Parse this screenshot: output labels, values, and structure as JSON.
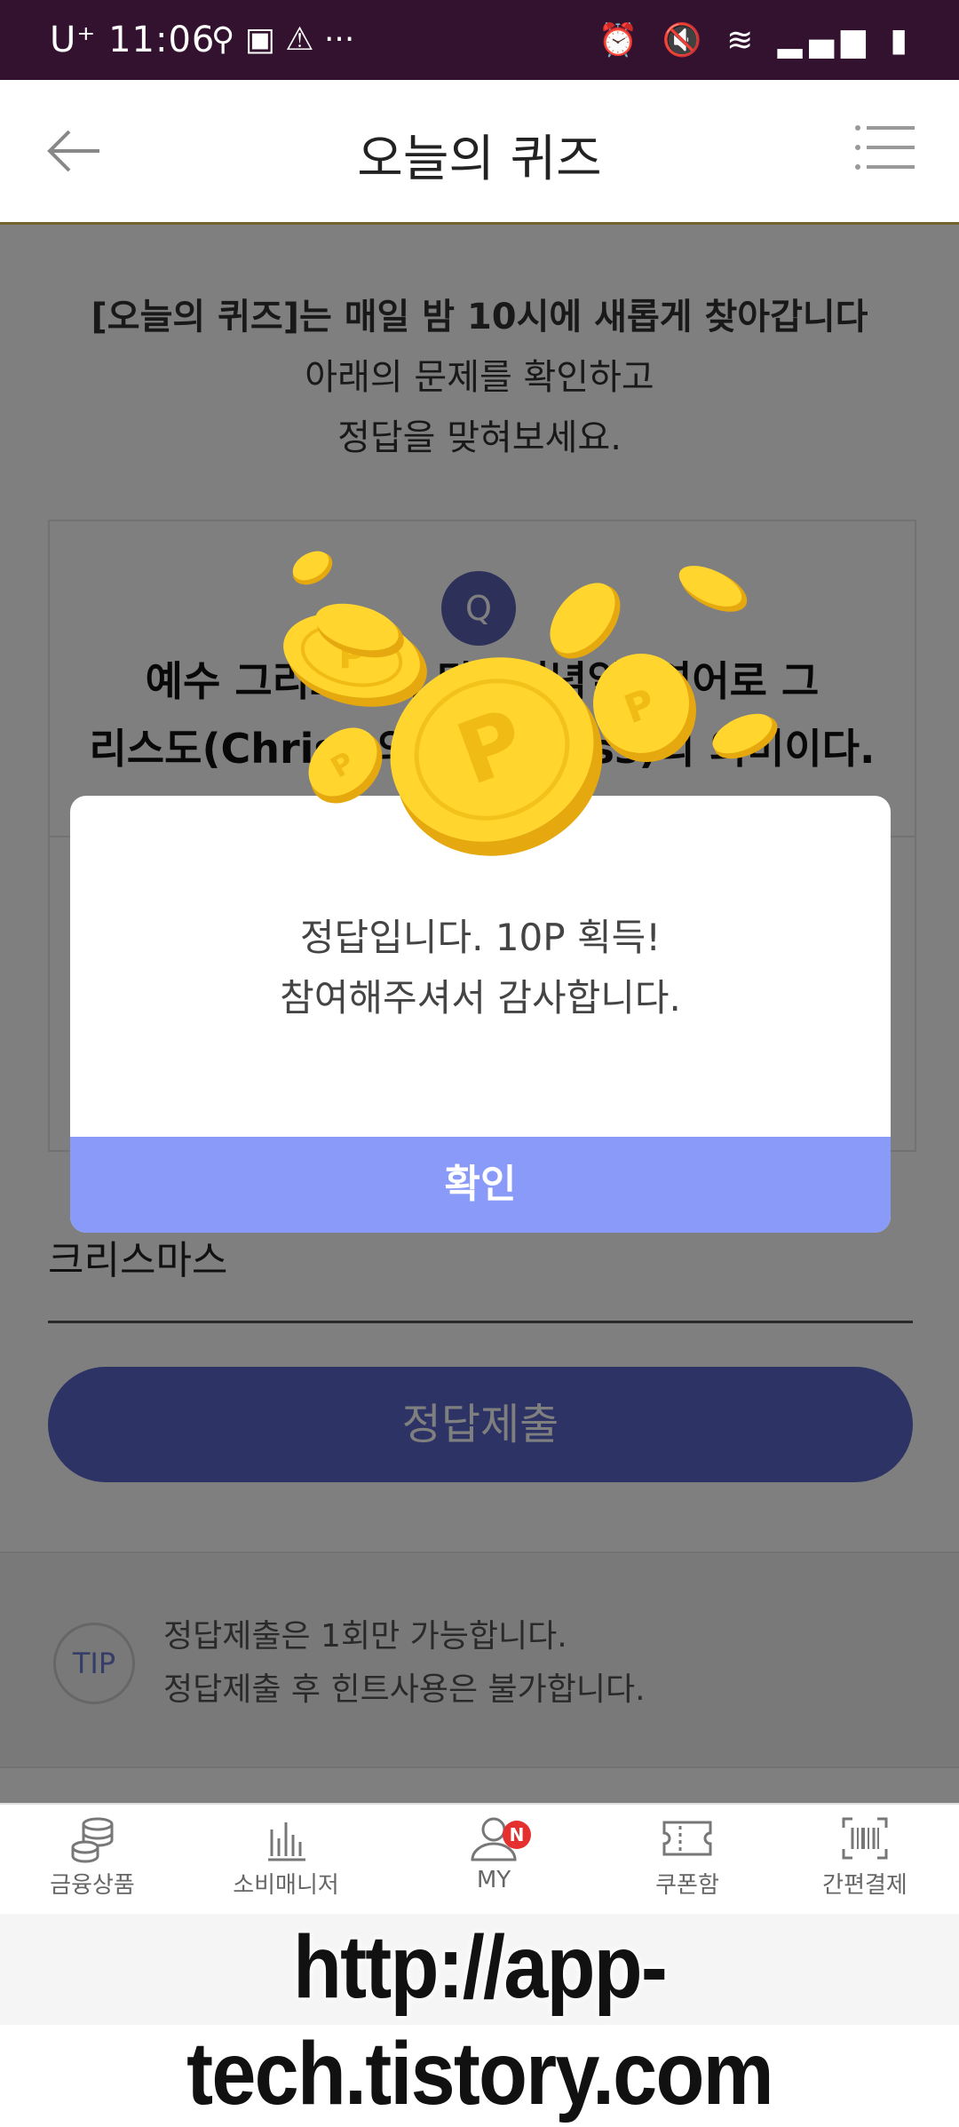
{
  "status_bar": {
    "carrier_time": "U⁺ 11:06",
    "left_icons": "⚲ ▣ ⚠ ···",
    "right_icons": "⏰ 🔇 ≋ ▂▄▆ ▮"
  },
  "header": {
    "title": "오늘의 퀴즈"
  },
  "intro": {
    "line1": "[오늘의 퀴즈]는 매일 밤 10시에 새롭게 찾아갑니다",
    "line2": "아래의 문제를 확인하고",
    "line3": "정답을 맞혀보세요."
  },
  "question": {
    "mark": "Q",
    "line1": "예수 그리스도의 탄생기념일, 영어로 그",
    "line2": "리스도(Christ)의 미사(Mass)의 의미이다."
  },
  "answer": {
    "value": "크리스마스",
    "submit_label": "정답제출"
  },
  "tip": {
    "icon_label": "TIP",
    "line1": "정답제출은 1회만 가능합니다.",
    "line2": "정답제출 후 힌트사용은 불가합니다."
  },
  "dialog": {
    "line1": "정답입니다. 10P 획득!",
    "line2": "참여해주셔서 감사합니다.",
    "confirm_label": "확인",
    "coin_symbol": "P"
  },
  "bottom_nav": {
    "items": [
      {
        "label": "금융상품",
        "icon": "coins-stack-icon"
      },
      {
        "label": "소비매니저",
        "icon": "bar-chart-icon"
      },
      {
        "label": "MY",
        "icon": "user-icon",
        "badge": "N"
      },
      {
        "label": "쿠폰함",
        "icon": "ticket-icon"
      },
      {
        "label": "간편결제",
        "icon": "barcode-icon"
      }
    ]
  },
  "watermark": {
    "text": "http://app-tech.tistory.com"
  },
  "colors": {
    "status_bar": "#33122f",
    "accent": "#5a66c8",
    "dialog_button": "#8a9af8",
    "coin": "#f5c518",
    "badge": "#e53030"
  }
}
